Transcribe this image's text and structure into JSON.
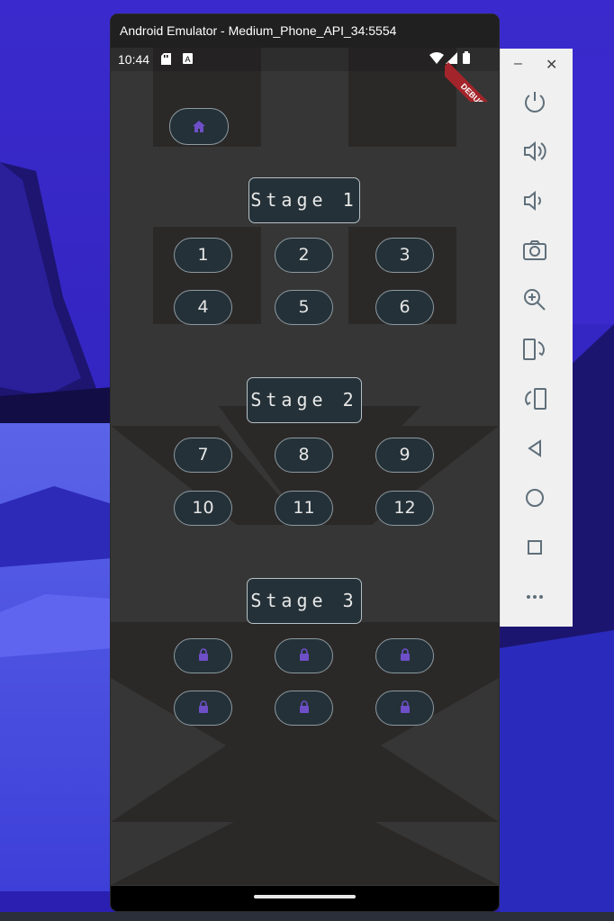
{
  "window": {
    "title": "Android Emulator - Medium_Phone_API_34:5554"
  },
  "status_bar": {
    "time": "10:44",
    "debug_label": "DEBUG"
  },
  "stages": [
    {
      "title": "Stage 1",
      "levels": [
        "1",
        "2",
        "3",
        "4",
        "5",
        "6"
      ],
      "locked": false
    },
    {
      "title": "Stage 2",
      "levels": [
        "7",
        "8",
        "9",
        "10",
        "11",
        "12"
      ],
      "locked": false
    },
    {
      "title": "Stage 3",
      "levels": [],
      "locked": true,
      "locked_count": 6
    }
  ],
  "toolbar": {
    "minimize_symbol": "–",
    "close_symbol": "✕",
    "buttons": [
      "power-icon",
      "volume-up-icon",
      "volume-down-icon",
      "camera-icon",
      "zoom-icon",
      "rotate-left-icon",
      "rotate-right-icon",
      "back-icon",
      "home-circle-icon",
      "overview-icon",
      "more-icon"
    ]
  },
  "colors": {
    "accent": "#6e4fc7",
    "pill_bg": "#243138",
    "screen_bg": "#363636"
  }
}
